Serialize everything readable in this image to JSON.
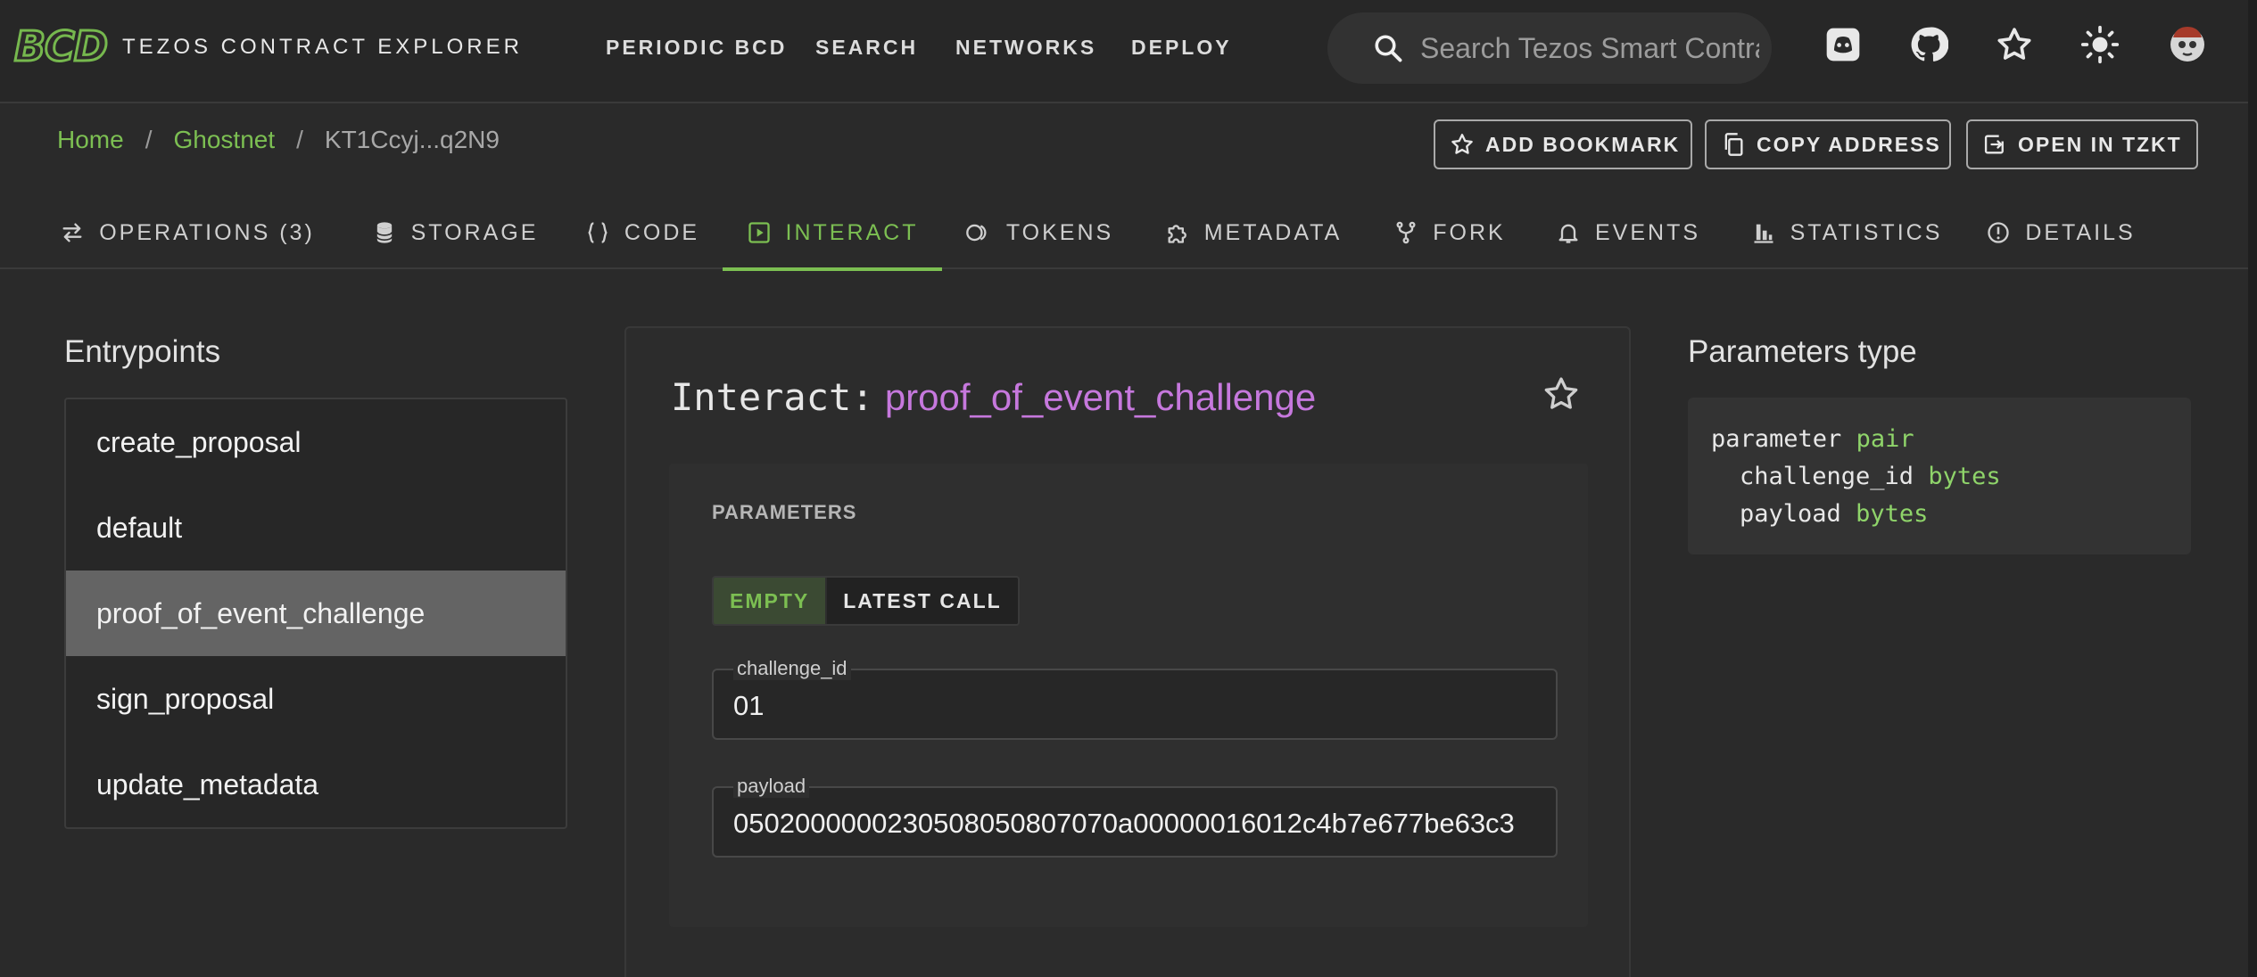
{
  "app": {
    "logo": "BCD",
    "title": "TEZOS CONTRACT EXPLORER",
    "nav": [
      "PERIODIC BCD",
      "SEARCH",
      "NETWORKS",
      "DEPLOY"
    ],
    "search_placeholder": "Search Tezos Smart Contracts"
  },
  "breadcrumb": {
    "home": "Home",
    "network": "Ghostnet",
    "address": "KT1Ccyj...q2N9"
  },
  "actions": {
    "bookmark": "ADD BOOKMARK",
    "copy": "COPY ADDRESS",
    "tzkt": "OPEN IN TZKT"
  },
  "tabs": [
    {
      "label": "OPERATIONS (3)",
      "icon": "swap-icon"
    },
    {
      "label": "STORAGE",
      "icon": "database-icon"
    },
    {
      "label": "CODE",
      "icon": "braces-icon"
    },
    {
      "label": "INTERACT",
      "icon": "play-box-icon"
    },
    {
      "label": "TOKENS",
      "icon": "coins-icon"
    },
    {
      "label": "METADATA",
      "icon": "puzzle-icon"
    },
    {
      "label": "FORK",
      "icon": "fork-icon"
    },
    {
      "label": "EVENTS",
      "icon": "bell-icon"
    },
    {
      "label": "STATISTICS",
      "icon": "chart-icon"
    },
    {
      "label": "DETAILS",
      "icon": "info-icon"
    }
  ],
  "entrypoints": {
    "title": "Entrypoints",
    "items": [
      "create_proposal",
      "default",
      "proof_of_event_challenge",
      "sign_proposal",
      "update_metadata"
    ],
    "selected": "proof_of_event_challenge"
  },
  "interact": {
    "prefix": "Interact:",
    "entrypoint": "proof_of_event_challenge",
    "parameters_label": "PARAMETERS",
    "toggle": {
      "empty": "EMPTY",
      "latest": "LATEST CALL"
    },
    "fields": [
      {
        "label": "challenge_id",
        "value": "01"
      },
      {
        "label": "payload",
        "value": "0502000000230508050807070a00000016012c4b7e677be63c3"
      }
    ]
  },
  "params_type": {
    "title": "Parameters type",
    "line1_kw": "parameter",
    "line1_type": "pair",
    "line2_name": "challenge_id",
    "line2_type": "bytes",
    "line3_name": "payload",
    "line3_type": "bytes"
  },
  "colors": {
    "accent": "#7cbf52",
    "entrypoint": "#c678dd",
    "background": "#2a2a2a"
  }
}
